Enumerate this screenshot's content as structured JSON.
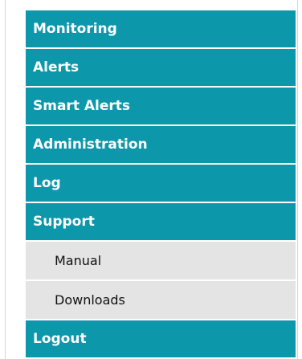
{
  "menu": {
    "items": [
      {
        "label": "Monitoring"
      },
      {
        "label": "Alerts"
      },
      {
        "label": "Smart Alerts"
      },
      {
        "label": "Administration"
      },
      {
        "label": "Log"
      },
      {
        "label": "Support"
      }
    ],
    "support_submenu": [
      {
        "label": "Manual"
      },
      {
        "label": "Downloads"
      }
    ],
    "logout": {
      "label": "Logout"
    }
  },
  "colors": {
    "menu_background": "#0d97ab",
    "menu_text": "#ffffff",
    "submenu_background": "#e4e4e4",
    "submenu_text": "#111111"
  }
}
